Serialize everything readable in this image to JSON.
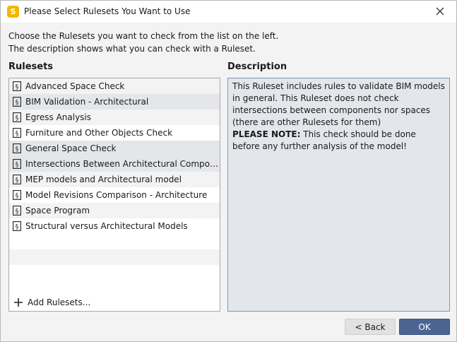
{
  "window": {
    "title": "Please Select Rulesets You Want to Use",
    "app_icon_letter": "S"
  },
  "intro": {
    "line1": "Choose the Rulesets you want to check from the list on the left.",
    "line2": "The description shows what you can check with a Ruleset."
  },
  "rulesets": {
    "heading": "Rulesets",
    "items": [
      {
        "label": "Advanced Space Check"
      },
      {
        "label": "BIM Validation - Architectural"
      },
      {
        "label": "Egress Analysis"
      },
      {
        "label": "Furniture and Other Objects Check"
      },
      {
        "label": "General Space Check"
      },
      {
        "label": "Intersections Between Architectural Components"
      },
      {
        "label": "MEP models and Architectural model"
      },
      {
        "label": "Model Revisions Comparison - Architecture"
      },
      {
        "label": "Space Program"
      },
      {
        "label": "Structural versus Architectural Models"
      }
    ],
    "add_label": "Add Rulesets..."
  },
  "description": {
    "heading": "Description",
    "text": "This Ruleset includes rules to validate BIM models in general. This Ruleset does not check intersections between components nor spaces (there are other Rulesets for them)",
    "note_label": "PLEASE NOTE:",
    "note_text": " This check should be done before any further analysis of the model!"
  },
  "buttons": {
    "back": "< Back",
    "ok": "OK"
  },
  "colors": {
    "ok_button": "#4a6591",
    "description_bg": "#e3e6eb",
    "app_icon": "#f2b705"
  }
}
